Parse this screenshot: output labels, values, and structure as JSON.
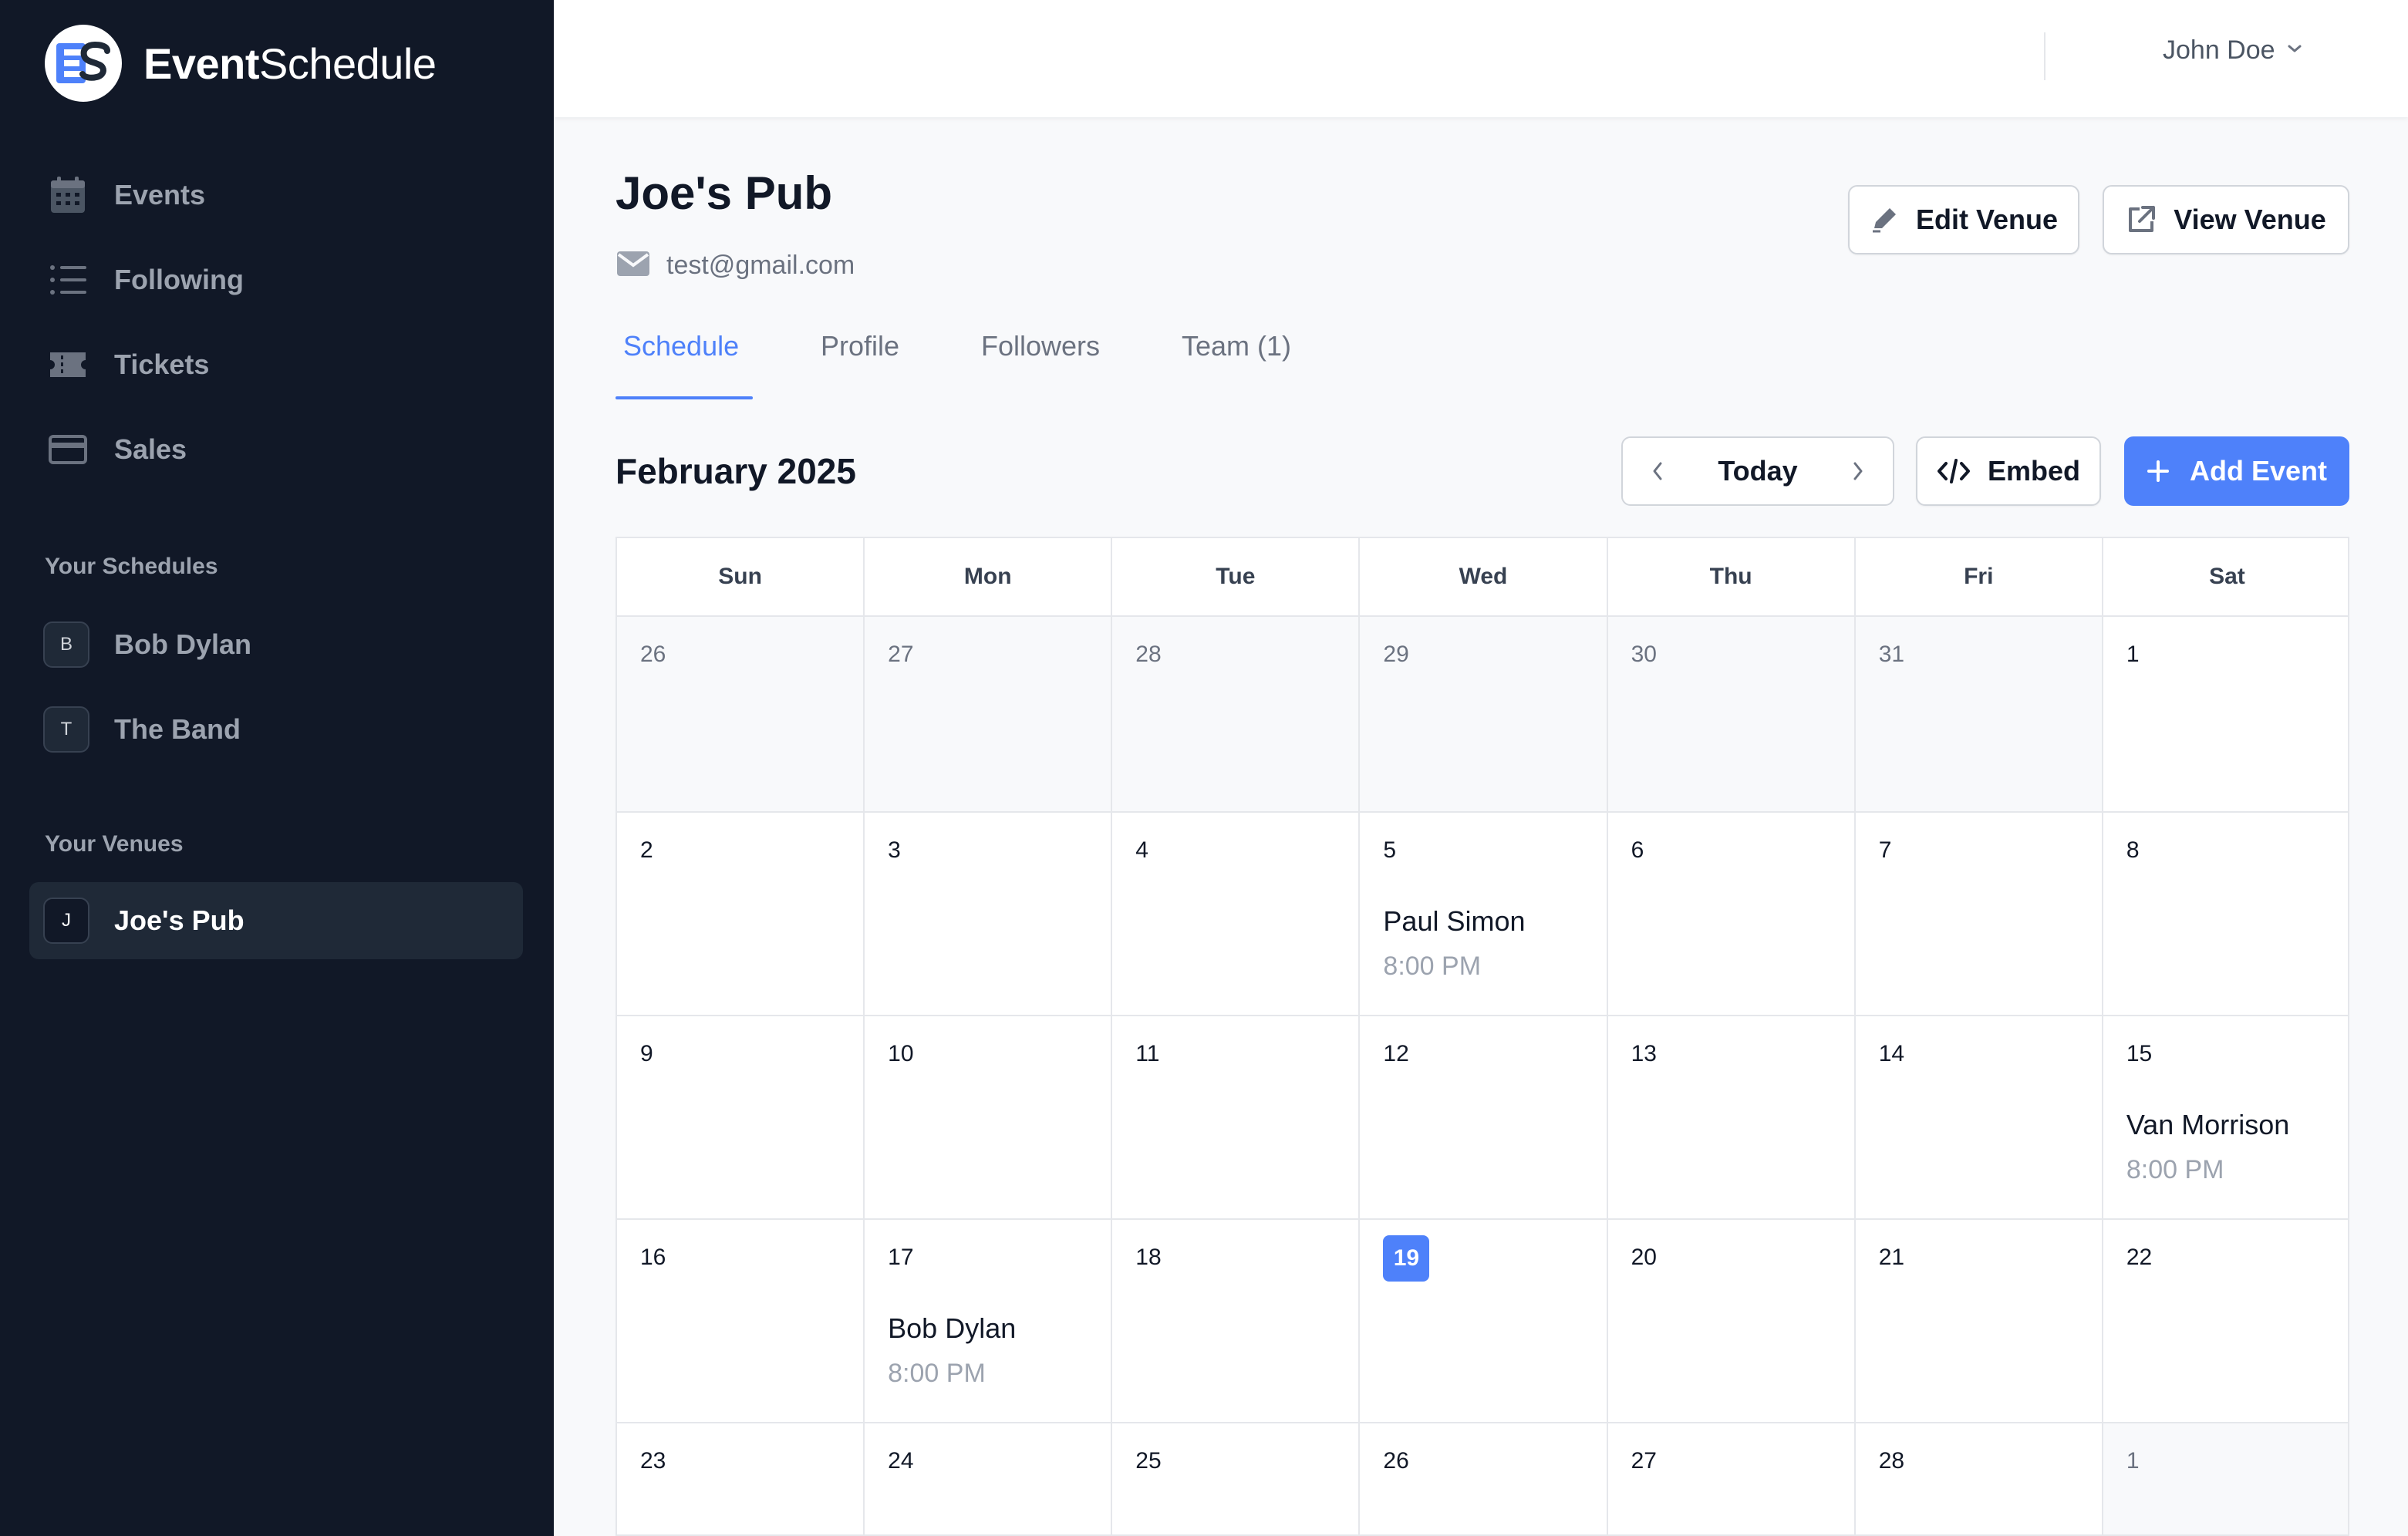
{
  "brand": {
    "name_bold": "Event",
    "name_regular": "Schedule",
    "logo_text": "ES"
  },
  "sidebar": {
    "nav": [
      {
        "label": "Events",
        "icon": "calendar-icon"
      },
      {
        "label": "Following",
        "icon": "list-icon"
      },
      {
        "label": "Tickets",
        "icon": "ticket-icon"
      },
      {
        "label": "Sales",
        "icon": "credit-card-icon"
      }
    ],
    "schedules_title": "Your Schedules",
    "schedules": [
      {
        "letter": "B",
        "label": "Bob Dylan"
      },
      {
        "letter": "T",
        "label": "The Band"
      }
    ],
    "venues_title": "Your Venues",
    "venues": [
      {
        "letter": "J",
        "label": "Joe's Pub",
        "active": true
      }
    ]
  },
  "topbar": {
    "user_name": "John Doe"
  },
  "venue": {
    "title": "Joe's Pub",
    "email": "test@gmail.com",
    "edit_label": "Edit Venue",
    "view_label": "View Venue"
  },
  "tabs": [
    {
      "label": "Schedule",
      "active": true
    },
    {
      "label": "Profile"
    },
    {
      "label": "Followers"
    },
    {
      "label": "Team (1)"
    }
  ],
  "calendar": {
    "month_label": "February 2025",
    "today_label": "Today",
    "embed_label": "Embed",
    "add_event_label": "Add Event",
    "weekdays": [
      "Sun",
      "Mon",
      "Tue",
      "Wed",
      "Thu",
      "Fri",
      "Sat"
    ],
    "today": 19,
    "weeks": [
      [
        {
          "d": "26",
          "o": true
        },
        {
          "d": "27",
          "o": true
        },
        {
          "d": "28",
          "o": true
        },
        {
          "d": "29",
          "o": true
        },
        {
          "d": "30",
          "o": true
        },
        {
          "d": "31",
          "o": true
        },
        {
          "d": "1"
        }
      ],
      [
        {
          "d": "2"
        },
        {
          "d": "3"
        },
        {
          "d": "4"
        },
        {
          "d": "5",
          "ev": {
            "name": "Paul Simon",
            "time": "8:00 PM"
          }
        },
        {
          "d": "6"
        },
        {
          "d": "7"
        },
        {
          "d": "8"
        }
      ],
      [
        {
          "d": "9"
        },
        {
          "d": "10"
        },
        {
          "d": "11"
        },
        {
          "d": "12"
        },
        {
          "d": "13"
        },
        {
          "d": "14"
        },
        {
          "d": "15",
          "ev": {
            "name": "Van Morrison",
            "time": "8:00 PM"
          }
        }
      ],
      [
        {
          "d": "16"
        },
        {
          "d": "17",
          "ev": {
            "name": "Bob Dylan",
            "time": "8:00 PM"
          }
        },
        {
          "d": "18"
        },
        {
          "d": "19",
          "today": true
        },
        {
          "d": "20"
        },
        {
          "d": "21"
        },
        {
          "d": "22"
        }
      ],
      [
        {
          "d": "23"
        },
        {
          "d": "24"
        },
        {
          "d": "25"
        },
        {
          "d": "26"
        },
        {
          "d": "27"
        },
        {
          "d": "28"
        },
        {
          "d": "1",
          "o": true
        }
      ]
    ]
  },
  "colors": {
    "accent": "#4e81fa",
    "sidebar_bg": "#111827",
    "page_bg": "#f8f9fb"
  }
}
